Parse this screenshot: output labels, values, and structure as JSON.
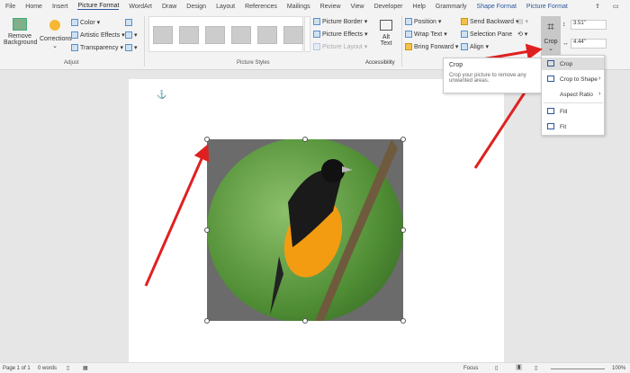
{
  "tabs": [
    "File",
    "Home",
    "Insert",
    "Picture Format",
    "WordArt",
    "Draw",
    "Design",
    "Layout",
    "References",
    "Mailings",
    "Review",
    "View",
    "Developer",
    "Help",
    "Grammarly",
    "Shape Format",
    "Picture Format"
  ],
  "ribbon": {
    "remove_bg": "Remove Background",
    "corrections": "Corrections",
    "color": "Color",
    "artistic": "Artistic Effects",
    "transparency": "Transparency",
    "adjust": "Adjust",
    "picture_styles": "Picture Styles",
    "border": "Picture Border",
    "effects": "Picture Effects",
    "layout": "Picture Layout",
    "alt_text": "Alt Text",
    "accessibility": "Accessibility",
    "position": "Position",
    "wrap": "Wrap Text",
    "bring_forward": "Bring Forward",
    "send_backward": "Send Backward",
    "selection_pane": "Selection Pane",
    "align": "Align",
    "crop": "Crop",
    "height": "3.51\"",
    "width": "4.44\""
  },
  "tooltip": {
    "title": "Crop",
    "text": "Crop your picture to remove any unwanted areas."
  },
  "crop_menu": [
    "Crop",
    "Crop to Shape",
    "Aspect Ratio",
    "Fill",
    "Fit"
  ],
  "status": {
    "page": "Page 1 of 1",
    "words": "0 words",
    "focus": "Focus",
    "zoom": "100%"
  },
  "colors": {
    "accent": "#2b579a",
    "arrow": "#e02020"
  }
}
